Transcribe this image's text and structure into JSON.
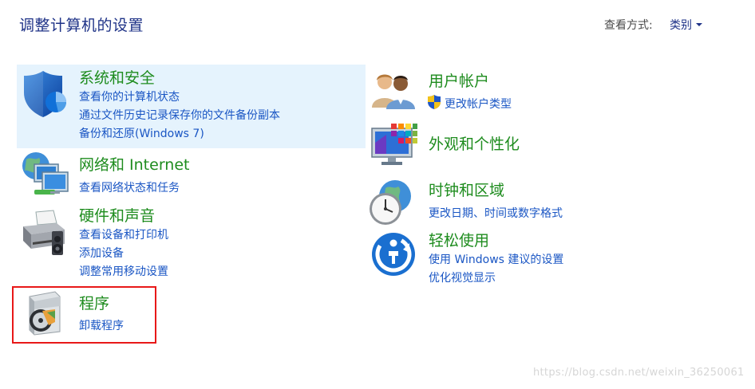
{
  "header": {
    "title": "调整计算机的设置",
    "view_by_label": "查看方式:",
    "view_by_value": "类别"
  },
  "categories": [
    {
      "icon": "shield-icon",
      "title": "系统和安全",
      "links": [
        "查看你的计算机状态",
        "通过文件历史记录保存你的文件备份副本",
        "备份和还原(Windows 7)"
      ]
    },
    {
      "icon": "network-icon",
      "title": "网络和 Internet",
      "links": [
        "查看网络状态和任务"
      ]
    },
    {
      "icon": "printer-icon",
      "title": "硬件和声音",
      "links": [
        "查看设备和打印机",
        "添加设备",
        "调整常用移动设置"
      ]
    },
    {
      "icon": "programs-icon",
      "title": "程序",
      "links": [
        "卸载程序"
      ]
    },
    {
      "icon": "users-icon",
      "title": "用户帐户",
      "links": [
        "更改帐户类型"
      ]
    },
    {
      "icon": "appearance-icon",
      "title": "外观和个性化",
      "links": []
    },
    {
      "icon": "clock-globe-icon",
      "title": "时钟和区域",
      "links": [
        "更改日期、时间或数字格式"
      ]
    },
    {
      "icon": "ease-of-access-icon",
      "title": "轻松使用",
      "links": [
        "使用 Windows 建议的设置",
        "优化视觉显示"
      ]
    }
  ],
  "watermark": "https://blog.csdn.net/weixin_36250061",
  "colors": {
    "title": "#1e3287",
    "category_title": "#1e8c1e",
    "link": "#1a56c4",
    "hover_background": "#e5f3fd",
    "highlight_border": "#e81818"
  }
}
